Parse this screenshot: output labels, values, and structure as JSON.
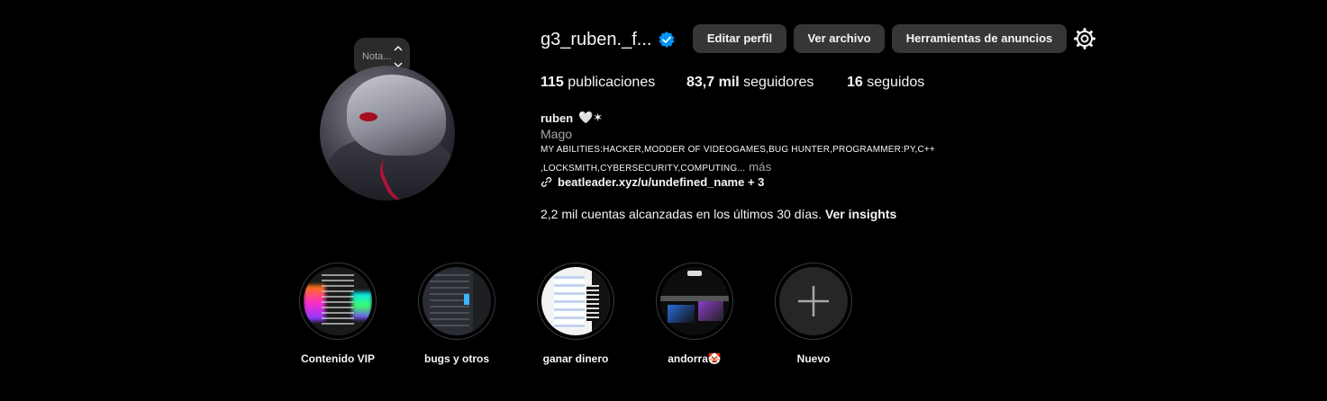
{
  "profile": {
    "username": "g3_ruben._f...",
    "note_placeholder": "Nota...",
    "buttons": {
      "edit_profile": "Editar perfil",
      "view_archive": "Ver archivo",
      "ad_tools": "Herramientas de anuncios"
    },
    "stats": {
      "posts_count": "115",
      "posts_label": "publicaciones",
      "followers_count": "83,7 mil",
      "followers_label": "seguidores",
      "following_count": "16",
      "following_label": "seguidos"
    },
    "bio": {
      "name": "ruben",
      "name_emojis": "🤍✶",
      "category": "Mago",
      "line1": "MY ABILITIES:HACKER,MODDER OF VIDEOGAMES,BUG HUNTER,PROGRAMMER:PY,C++",
      "line2": ",LOCKSMITH,CYBERSECURITY,COMPUTING...",
      "more": "más",
      "link": "beatleader.xyz/u/undefined_name + 3"
    },
    "insights": {
      "text": "2,2 mil cuentas alcanzadas en los últimos 30 días.",
      "link": "Ver insights"
    }
  },
  "highlights": [
    {
      "label": "Contenido VIP"
    },
    {
      "label": "bugs y otros"
    },
    {
      "label": "ganar dinero"
    },
    {
      "label": "andorra🤡"
    },
    {
      "label": "Nuevo"
    }
  ],
  "colors": {
    "background": "#000000",
    "button": "#363636",
    "verified": "#0095f6",
    "secondary_text": "#a8a8a8"
  },
  "icons": [
    "verified-badge-icon",
    "settings-gear-icon",
    "link-icon",
    "plus-icon",
    "chevron-up-icon",
    "chevron-down-icon"
  ]
}
